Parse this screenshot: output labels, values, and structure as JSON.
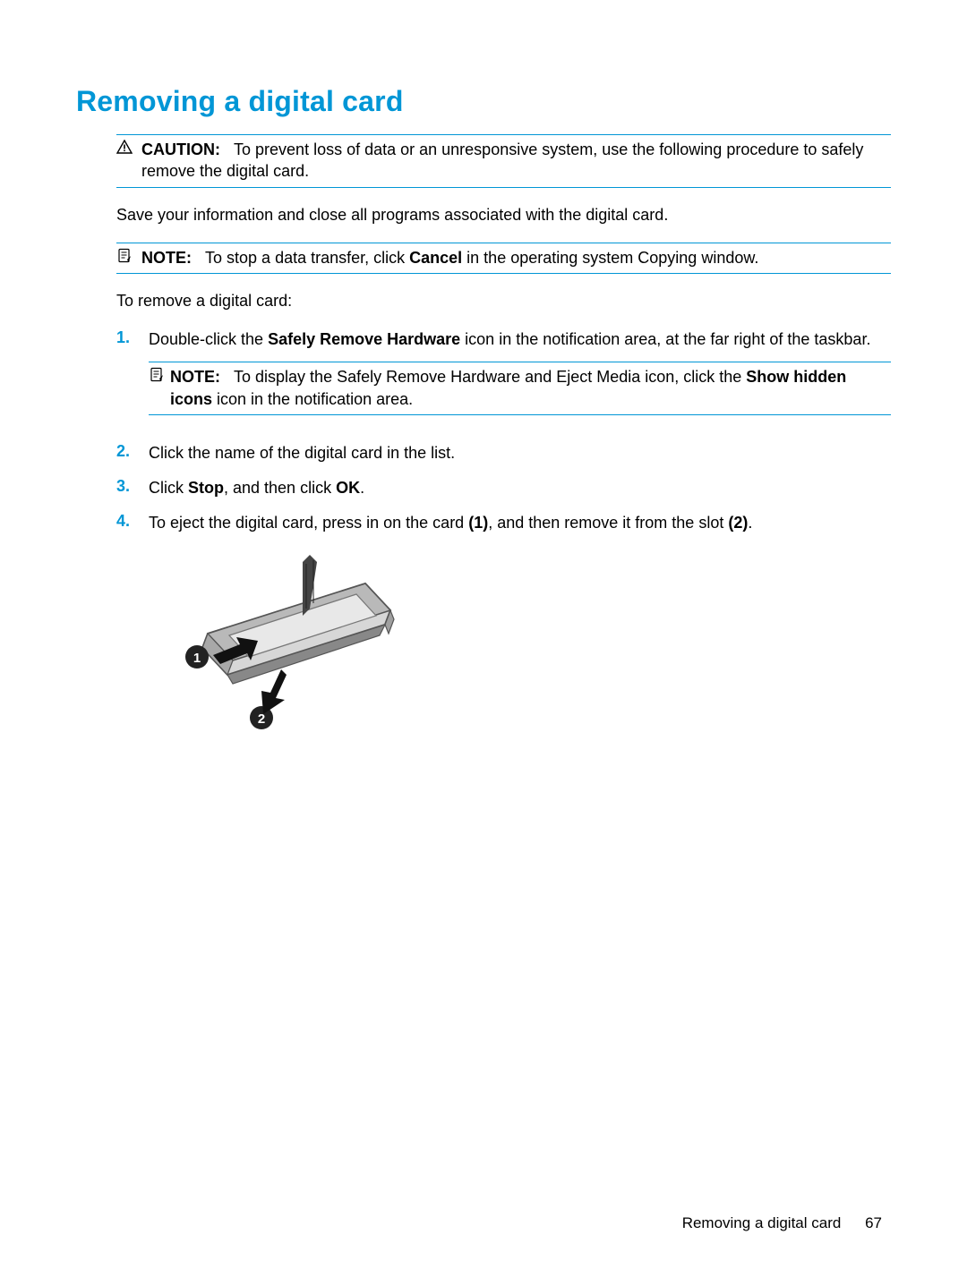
{
  "title": "Removing a digital card",
  "caution": {
    "label": "CAUTION:",
    "text": "To prevent loss of data or an unresponsive system, use the following procedure to safely remove the digital card."
  },
  "intro_para": "Save your information and close all programs associated with the digital card.",
  "note_top": {
    "label": "NOTE:",
    "pre": "To stop a data transfer, click ",
    "bold": "Cancel",
    "post": " in the operating system Copying window."
  },
  "lead_in": "To remove a digital card:",
  "steps": [
    {
      "num": "1.",
      "pre": "Double-click the ",
      "bold1": "Safely Remove Hardware",
      "post": " icon in the notification area, at the far right of the taskbar.",
      "nested_note": {
        "label": "NOTE:",
        "pre": "To display the Safely Remove Hardware and Eject Media icon, click the ",
        "bold1": "Show hidden icons",
        "post": " icon in the notification area."
      }
    },
    {
      "num": "2.",
      "text": "Click the name of the digital card in the list."
    },
    {
      "num": "3.",
      "pre": "Click ",
      "bold1": "Stop",
      "mid": ", and then click ",
      "bold2": "OK",
      "post": "."
    },
    {
      "num": "4.",
      "pre": "To eject the digital card, press in on the card ",
      "bold1": "(1)",
      "mid": ", and then remove it from the slot ",
      "bold2": "(2)",
      "post": "."
    }
  ],
  "footer": {
    "section": "Removing a digital card",
    "page": "67"
  }
}
